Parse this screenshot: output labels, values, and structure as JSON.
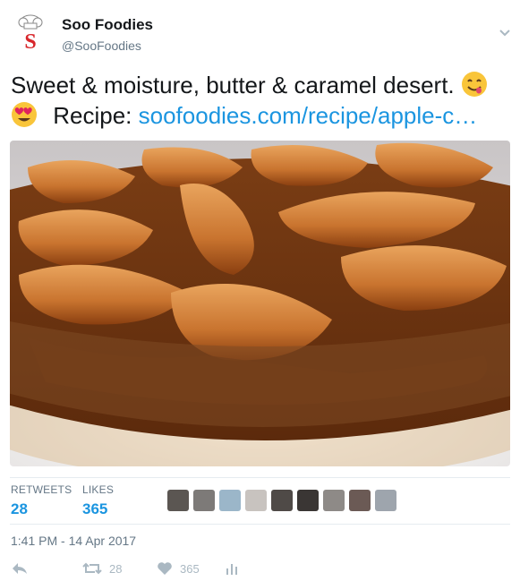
{
  "author": {
    "name": "Soo Foodies",
    "handle": "@SooFoodies",
    "logo_letter": "S"
  },
  "tweet": {
    "text_part1": "Sweet & moisture, butter & caramel desert.",
    "emoji1": "smiling-face-savoring-food",
    "emoji2": "smiling-face-heart-eyes",
    "text_part2": "Recipe:",
    "link": "soofoodies.com/recipe/apple-c…"
  },
  "photo": {
    "subject": "caramel apple upside-down cake"
  },
  "stats": {
    "retweets_label": "RETWEETS",
    "retweets_count": "28",
    "likes_label": "LIKES",
    "likes_count": "365"
  },
  "likers": [
    {
      "icon": "liker-avatar-1"
    },
    {
      "icon": "liker-avatar-2"
    },
    {
      "icon": "liker-avatar-3"
    },
    {
      "icon": "liker-avatar-4"
    },
    {
      "icon": "liker-avatar-5"
    },
    {
      "icon": "liker-avatar-6"
    },
    {
      "icon": "liker-avatar-7"
    },
    {
      "icon": "liker-avatar-8"
    },
    {
      "icon": "liker-avatar-9"
    }
  ],
  "timestamp": "1:41 PM - 14 Apr 2017",
  "actions": {
    "retweet_count": "28",
    "like_count": "365"
  },
  "colors": {
    "link": "#1b95e0",
    "secondary": "#657786",
    "action_gray": "#aab8c2",
    "logo_red": "#d8262b"
  }
}
